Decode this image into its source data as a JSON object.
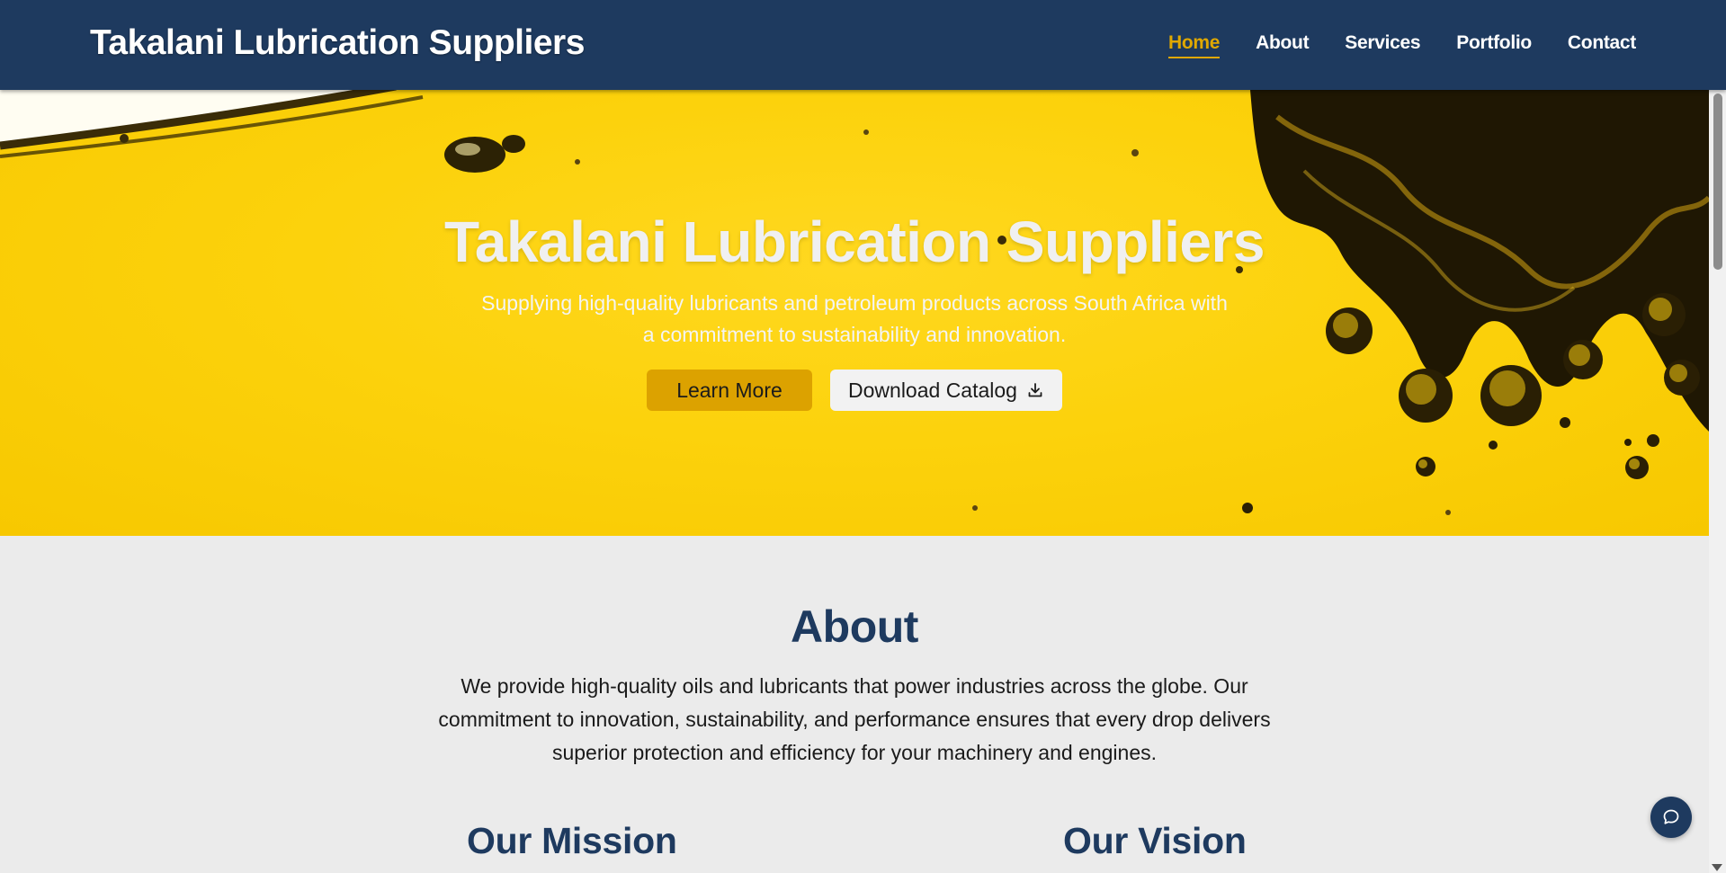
{
  "header": {
    "brand": "Takalani Lubrication Suppliers",
    "nav": [
      "Home",
      "About",
      "Services",
      "Portfolio",
      "Contact"
    ],
    "active": "Home"
  },
  "hero": {
    "title": "Takalani Lubrication Suppliers",
    "subtitle": "Supplying high-quality lubricants and petroleum products across South Africa with a commitment to sustainability and innovation.",
    "learn_more": "Learn More",
    "download_catalog": "Download Catalog",
    "download_icon": "download-icon"
  },
  "about": {
    "title": "About",
    "text": "We provide high-quality oils and lubricants that power industries across the globe. Our commitment to innovation, sustainability, and performance ensures that every drop delivers superior protection and efficiency for your machinery and engines.",
    "mission_title": "Our Mission",
    "vision_title": "Our Vision"
  },
  "chat": {
    "icon": "chat-bubble-icon"
  },
  "colors": {
    "header_bg": "#1e3a5f",
    "accent": "#e0a800",
    "hero_yellow": "#fcd20c",
    "button_primary": "#dca200",
    "page_bg": "#ebebeb"
  }
}
